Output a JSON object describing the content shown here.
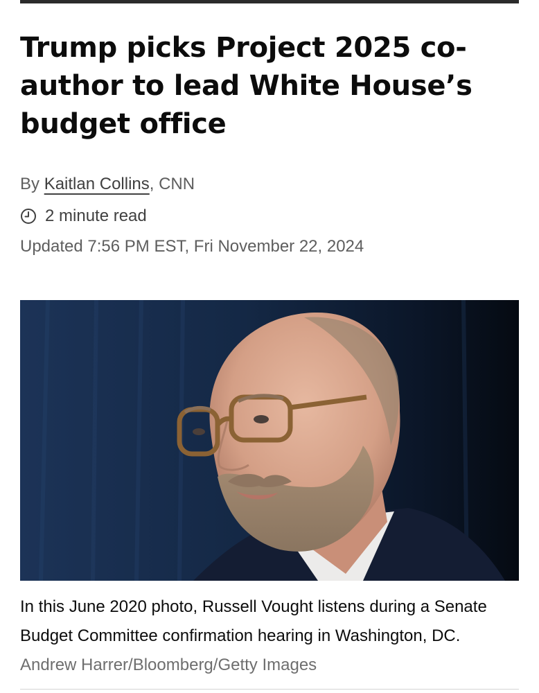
{
  "article": {
    "headline": "Trump picks Project 2025 co-author to lead White House’s budget office",
    "byline_prefix": "By ",
    "author": "Kaitlan Collins",
    "byline_suffix": ", CNN",
    "read_time": "2 minute read",
    "updated": "Updated 7:56 PM EST, Fri November 22, 2024"
  },
  "image": {
    "caption": "In this June 2020 photo, Russell Vought listens during a Senate Budget Committee confirmation hearing in Washington, DC.",
    "credit": "Andrew Harrer/Bloomberg/Getty Images"
  },
  "icons": {
    "read_time_icon": "clock-icon"
  },
  "colors": {
    "headline": "#0c0c0c",
    "meta_text": "#5e5e5e",
    "credit": "#6e6e6e",
    "photo_background": "#0e1a2c"
  }
}
